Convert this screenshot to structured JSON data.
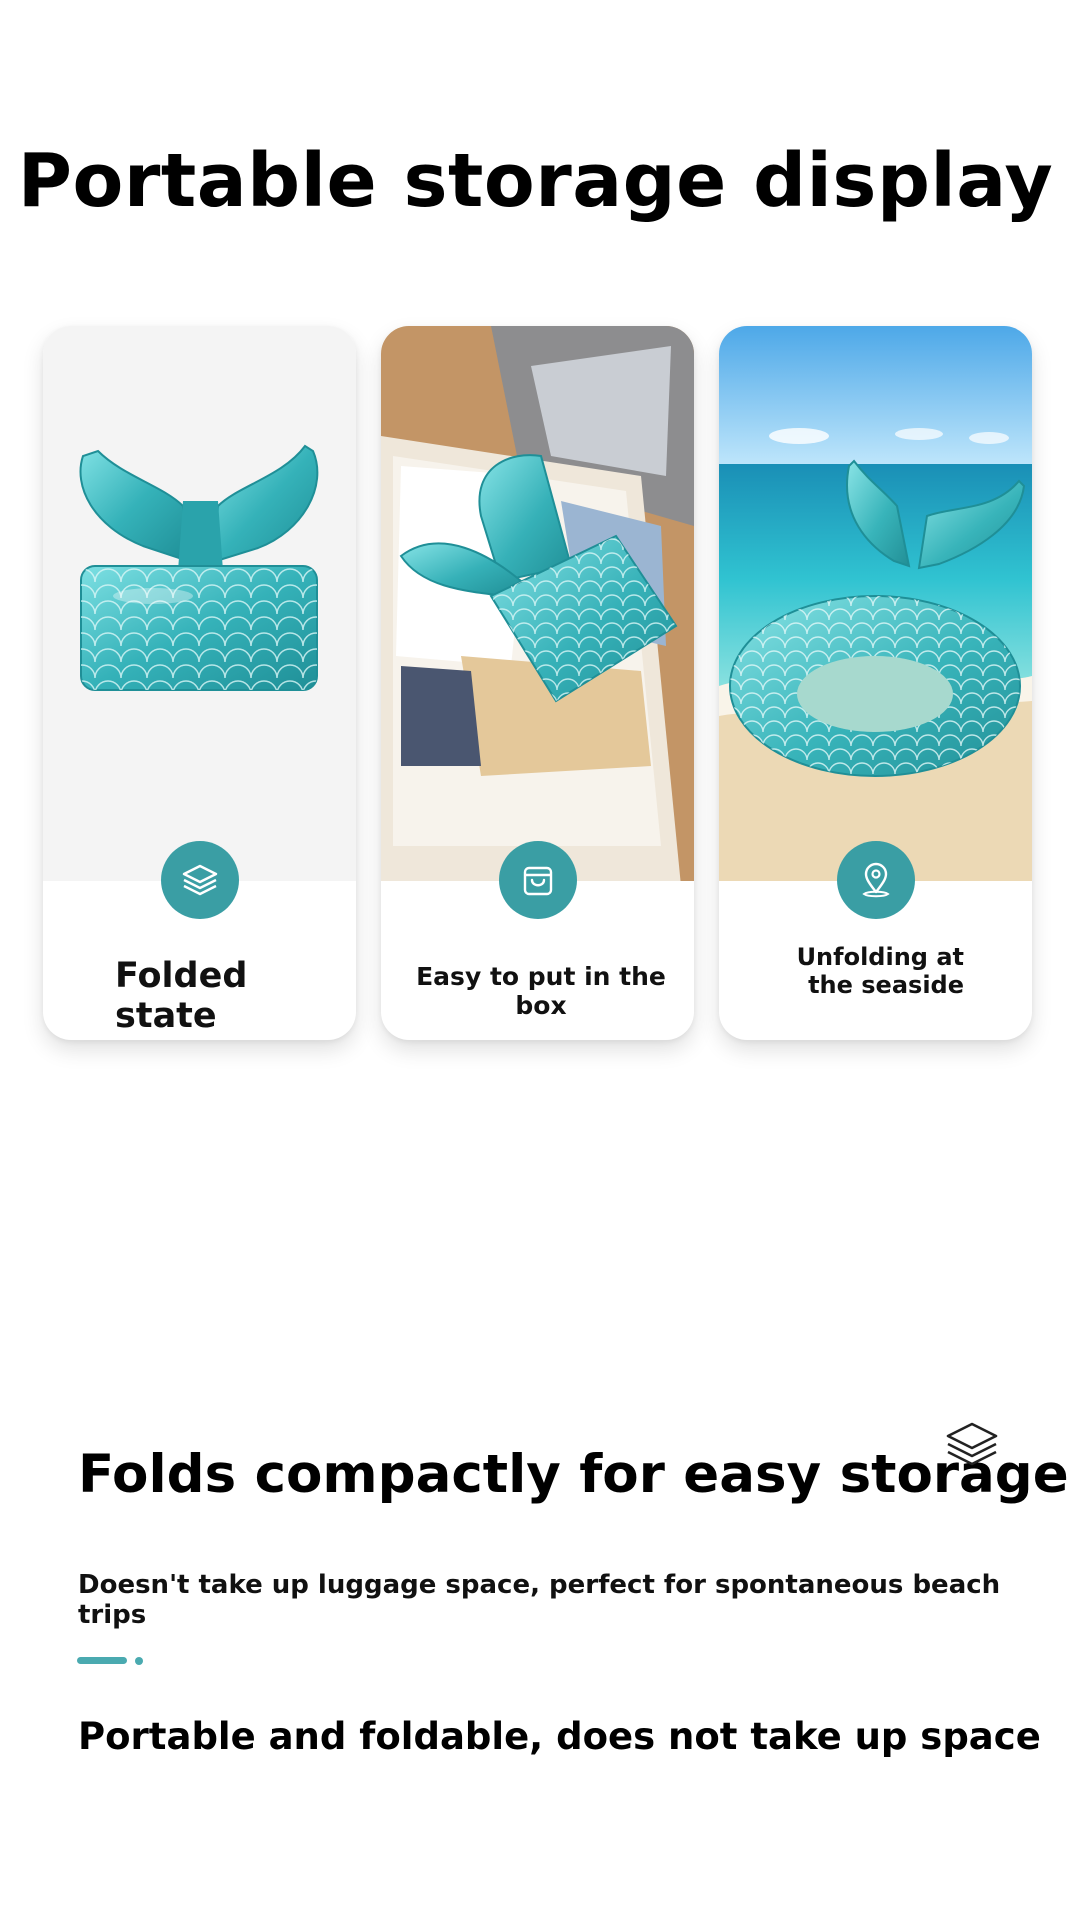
{
  "page": {
    "title": "Portable storage display"
  },
  "cards": [
    {
      "label": "Folded state",
      "icon": "layers-icon",
      "image": "folded-mermaid-tail-float"
    },
    {
      "label": "Easy to put in the box",
      "icon": "shopping-bag-icon",
      "image": "float-packed-in-suitcase"
    },
    {
      "label": "Unfolding at the seaside",
      "icon": "location-pin-icon",
      "image": "inflated-float-on-beach"
    }
  ],
  "feature": {
    "title": "Folds compactly for easy storage",
    "icon": "layers-icon",
    "subtitle": "Doesn't take up luggage space, perfect for spontaneous beach trips",
    "footer": "Portable and foldable, does not take up space"
  },
  "colors": {
    "accent": "#3a9ea4",
    "float_teal": "#3fb7bd"
  }
}
